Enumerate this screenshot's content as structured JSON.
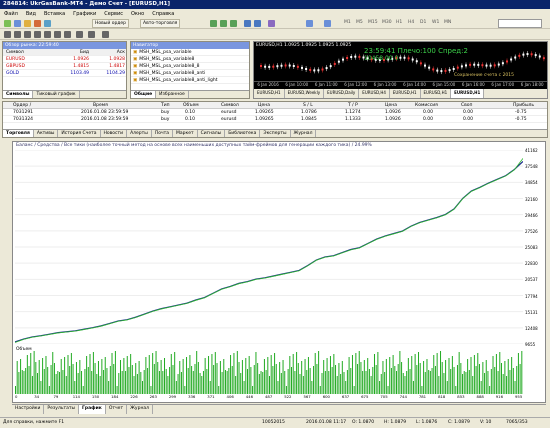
{
  "app": {
    "title": "284814: UkrGasBank-MT4 - Демо Счет - [EURUSD,H1]"
  },
  "menu": [
    "Файл",
    "Вид",
    "Вставка",
    "Графики",
    "Сервис",
    "Окно",
    "Справка"
  ],
  "toolbar": {
    "new_order": "Новый ордер",
    "autotrading": "Авто-торговля",
    "timeframes": [
      "M1",
      "M5",
      "M15",
      "M30",
      "H1",
      "H4",
      "D1",
      "W1",
      "MN"
    ]
  },
  "market_watch": {
    "title": "Обзор рынка: 22:59:40",
    "headers": [
      "Символ",
      "Бид",
      "Аск"
    ],
    "rows": [
      {
        "symbol": "EURUSD",
        "bid": "1.0926",
        "ask": "1.0928"
      },
      {
        "symbol": "GBPUSD",
        "bid": "1.4815",
        "ask": "1.4817"
      },
      {
        "symbol": "GOLD",
        "bid": "1103.49",
        "ask": "1104.29"
      }
    ],
    "tabs": [
      "Символы",
      "Тиковый график"
    ]
  },
  "navigator": {
    "title": "Навигатор",
    "items": [
      "MSH_MSL_psa_variable",
      "MSH_MSL_psa_variable8",
      "MSH_MSL_psa_variable8_8",
      "MSH_MSL_psa_variable8_anti",
      "MSH_MSL_psa_variable8_anti_light"
    ],
    "tabs": [
      "Общие",
      "Избранное"
    ]
  },
  "mini_chart": {
    "symbol": "EURUSD,H1",
    "ohlc": "1.0925 1.0925 1.0925 1.0925",
    "overlay1": "23:59:41 Плечо:100 Спред:2",
    "overlay2": "10458.00 0",
    "note": "Сохранение счета с 2015",
    "ticks": [
      "6 Jan 2016",
      "6 Jan 10:00",
      "6 Jan 11:00",
      "6 Jan 12:00",
      "6 Jan 13:00",
      "6 Jan 14:00",
      "6 Jan 15:00",
      "6 Jan 16:00",
      "6 Jan 17:00",
      "6 Jan 18:00"
    ],
    "tabs": [
      "EURUSD,H1",
      "EURUSD,Weekly",
      "EURUSD,Daily",
      "EURUSD,H4",
      "EURUSD,H1",
      "EURUSD,H1",
      "EURUSD,H1"
    ]
  },
  "orders": {
    "headers": [
      "Ордер /",
      "Время",
      "Тип",
      "Объем",
      "Символ",
      "Цена",
      "S / L",
      "T / P",
      "Цена",
      "Комиссия",
      "Своп",
      "Прибыль"
    ],
    "rows": [
      {
        "order": "7031291",
        "time": "2016.01.08 23:59:59",
        "type": "buy",
        "volume": "0.10",
        "symbol": "eurusd",
        "price": "1.09265",
        "sl": "1.0786",
        "tp": "1.1274",
        "cur": "1.0926",
        "comm": "0.00",
        "swap": "0.00",
        "profit": "-0.75"
      },
      {
        "order": "7031324",
        "time": "2016.01.08 23:59:59",
        "type": "buy",
        "volume": "0.10",
        "symbol": "eurusd",
        "price": "1.09265",
        "sl": "1.0845",
        "tp": "1.1333",
        "cur": "1.0926",
        "comm": "0.00",
        "swap": "0.00",
        "profit": "-0.75"
      }
    ],
    "tabs": [
      "Торговля",
      "Активы",
      "История Счета",
      "Новости",
      "Алерты",
      "Почта",
      "Маркет",
      "Сигналы",
      "Библиотека",
      "Эксперты",
      "Журнал"
    ]
  },
  "tester": {
    "caption": "Баланс / Средства / Все тики (наиболее точный метод на основе всех наименьших доступных тайм-фреймов для генерации каждого тика) / 24.99%",
    "volume_label": "Объем",
    "yticks": [
      "41162",
      "37548",
      "34854",
      "32160",
      "29466",
      "27526",
      "25083",
      "22830",
      "20537",
      "17794",
      "15131",
      "12408",
      "9655"
    ],
    "xticks": [
      "0",
      "34",
      "79",
      "114",
      "150",
      "184",
      "226",
      "263",
      "299",
      "336",
      "371",
      "406",
      "446",
      "487",
      "522",
      "567",
      "600",
      "637",
      "675",
      "705",
      "744",
      "781",
      "818",
      "853",
      "888",
      "916",
      "955"
    ],
    "tabs": [
      "Настройки",
      "Результаты",
      "График",
      "Отчет",
      "Журнал"
    ],
    "chart_data": {
      "type": "line",
      "series": [
        {
          "name": "Баланс",
          "values": [
            10000,
            10450,
            10800,
            11000,
            11250,
            11500,
            11650,
            11800,
            12050,
            12300,
            12600,
            13000,
            13400,
            13600,
            14000,
            14500,
            15000,
            15400,
            15700,
            16000,
            16300,
            16800,
            17200,
            17900,
            18600,
            19000,
            19500,
            19800,
            20200,
            20400,
            20700,
            21000,
            21300,
            21600,
            22400,
            23300,
            23800,
            24000,
            24500,
            25000,
            25300,
            26000,
            26700,
            27200,
            27600,
            28000,
            28800,
            29400,
            29800,
            30200,
            30700,
            31600,
            33300,
            34500,
            35100,
            35800,
            36400,
            37000,
            38000,
            39300
          ]
        },
        {
          "name": "Средства",
          "values": [
            9900,
            10400,
            10750,
            10950,
            11200,
            11450,
            11600,
            11750,
            12000,
            12250,
            12550,
            12950,
            13350,
            13550,
            13950,
            14450,
            14950,
            15350,
            15650,
            15950,
            16250,
            16750,
            17150,
            17850,
            18550,
            18950,
            19450,
            19750,
            20150,
            20350,
            20650,
            20950,
            21250,
            21550,
            22350,
            23250,
            23750,
            23950,
            24450,
            24950,
            25250,
            25950,
            26650,
            27150,
            27550,
            27950,
            28750,
            29350,
            29750,
            30150,
            30650,
            31550,
            33250,
            34450,
            35050,
            35750,
            36350,
            36950,
            37950,
            39800
          ]
        }
      ]
    }
  },
  "status": {
    "help": "Для справки, нажмите F1",
    "profile": "10052015",
    "time": "2016.01.08 11:17",
    "open": "O: 1.0870",
    "high": "H: 1.0879",
    "low": "L: 1.0876",
    "close": "C: 1.0879",
    "volume": "V: 10",
    "traffic": "7065/353"
  }
}
